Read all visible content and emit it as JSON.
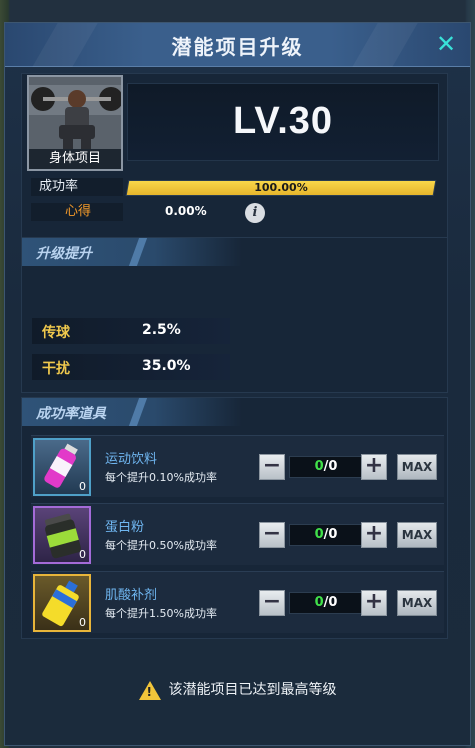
{
  "title": "潜能项目升级",
  "close_icon": "close-icon",
  "header": {
    "item_name": "身体项目",
    "level": "LV.30"
  },
  "success_rate": {
    "label": "成功率",
    "value": "100.00%",
    "fill": 1.0
  },
  "insight": {
    "label": "心得",
    "value": "0.00%"
  },
  "upgrade_section": {
    "title": "升级提升",
    "stats": [
      {
        "label": "传球",
        "value": "2.5%"
      },
      {
        "label": "干扰",
        "value": "35.0%"
      }
    ]
  },
  "items_section": {
    "title": "成功率道具",
    "items": [
      {
        "name": "运动饮料",
        "desc": "每个提升0.10%成功率",
        "count": "0",
        "qty_current": "0",
        "qty_total": "/0",
        "max_label": "MAX",
        "border": "#4fa0c8"
      },
      {
        "name": "蛋白粉",
        "desc": "每个提升0.50%成功率",
        "count": "0",
        "qty_current": "0",
        "qty_total": "/0",
        "max_label": "MAX",
        "border": "#a46bd8"
      },
      {
        "name": "肌酸补剂",
        "desc": "每个提升1.50%成功率",
        "count": "0",
        "qty_current": "0",
        "qty_total": "/0",
        "max_label": "MAX",
        "border": "#e8b53a"
      }
    ]
  },
  "notice": "该潜能项目已达到最高等级"
}
